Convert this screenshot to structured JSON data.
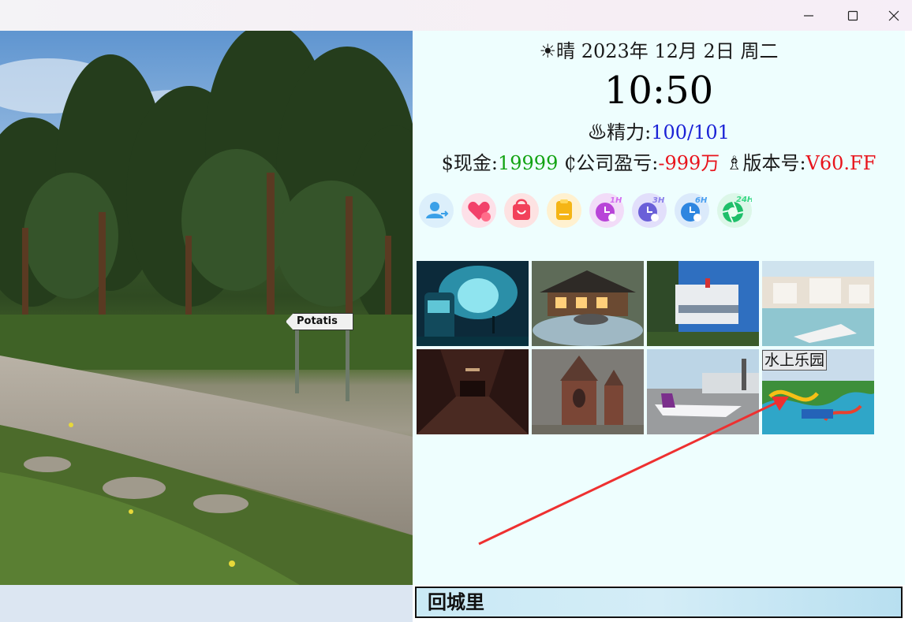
{
  "window": {
    "minimize_icon": "minimize-icon",
    "maximize_icon": "maximize-icon",
    "close_icon": "close-icon"
  },
  "scene": {
    "sign_text": "Potatis"
  },
  "status": {
    "weather_icon": "☀",
    "weather": "晴",
    "date": "2023年 12月 2日 周二",
    "time": "10:50",
    "energy_icon": "♨",
    "energy_label": "精力:",
    "energy_value": "100/101",
    "cash_icon": "$",
    "cash_label": "现金:",
    "cash_value": "19999",
    "company_icon": "₵",
    "company_label": "公司盈亏:",
    "company_value": "-999万",
    "version_icon": "♗",
    "version_label": "版本号:",
    "version_value": "V60.FF"
  },
  "quick_icons": [
    {
      "name": "profile-icon",
      "color": "#3aa0e8"
    },
    {
      "name": "heart-icon",
      "color": "#f2416a"
    },
    {
      "name": "shopping-bag-icon",
      "color": "#f2415a"
    },
    {
      "name": "notepad-icon",
      "color": "#f5b515"
    },
    {
      "name": "clock-1h-icon",
      "badge": "1H",
      "color": "#b844d8"
    },
    {
      "name": "clock-3h-icon",
      "badge": "3H",
      "color": "#6a5fd8"
    },
    {
      "name": "clock-6h-icon",
      "badge": "6H",
      "color": "#2e86e0"
    },
    {
      "name": "camera-24h-icon",
      "badge": "24H",
      "color": "#1fbf6a"
    }
  ],
  "locations": [
    {
      "name": "subway-station-tile"
    },
    {
      "name": "hot-spring-resort-tile"
    },
    {
      "name": "modern-building-tile"
    },
    {
      "name": "seaside-villa-tile"
    },
    {
      "name": "dark-corridor-tile"
    },
    {
      "name": "old-church-tile"
    },
    {
      "name": "airport-tile"
    },
    {
      "name": "water-park-tile",
      "label": "水上乐园"
    }
  ],
  "bottom": {
    "back_label": "回城里"
  },
  "colors": {
    "panel_bg": "#eefefe",
    "energy_value": "#1b22d6",
    "cash_value": "#13a313",
    "negative_value": "#e8141c",
    "arrow": "#ee3030"
  }
}
